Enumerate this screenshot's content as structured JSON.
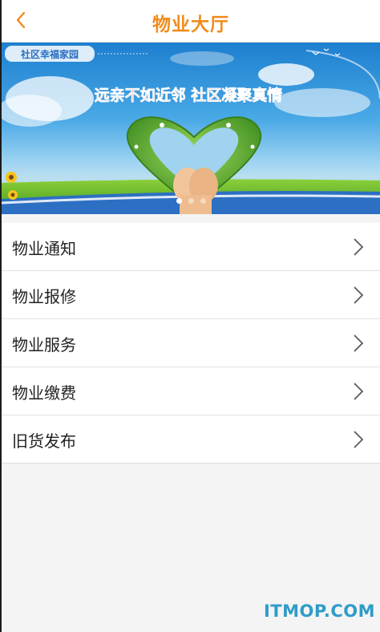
{
  "header": {
    "title": "物业大厅"
  },
  "banner": {
    "logo_text": "社区幸福家园",
    "slogan": "远亲不如近邻 社区凝聚真情",
    "carousel_total": 3,
    "carousel_active": 1
  },
  "menu": {
    "items": [
      {
        "label": "物业通知"
      },
      {
        "label": "物业报修"
      },
      {
        "label": "物业服务"
      },
      {
        "label": "物业缴费"
      },
      {
        "label": "旧货发布"
      }
    ]
  },
  "watermark": "ITMOP.COM",
  "colors": {
    "accent": "#f08c1c",
    "slogan_red": "#e2231a",
    "watermark": "#2f9cc9"
  }
}
